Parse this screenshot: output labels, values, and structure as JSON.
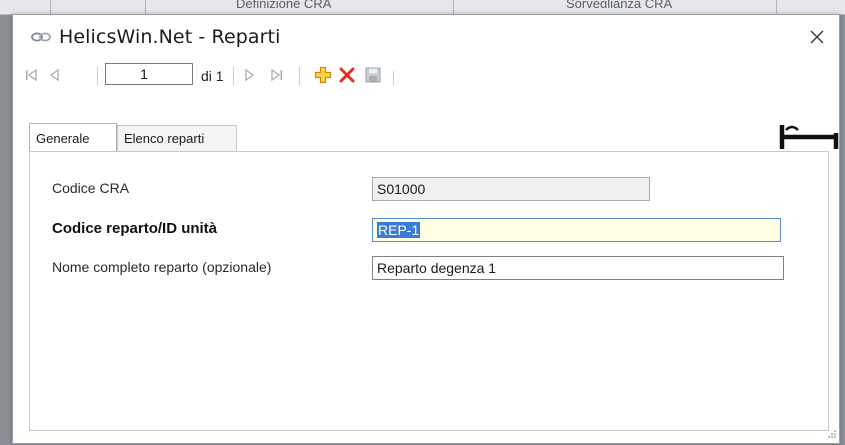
{
  "background_app": {
    "tabs": [
      "Definizione CRA",
      "Sorveglianza CRA"
    ]
  },
  "window": {
    "title": "HelicsWin.Net - Reparti",
    "icons": {
      "app": "link-icon",
      "close": "close-icon"
    }
  },
  "toolbar": {
    "position_value": "1",
    "of_label": "di 1",
    "icons": [
      "first-record-icon",
      "previous-record-icon",
      "next-record-icon",
      "last-record-icon",
      "add-icon",
      "delete-icon",
      "save-icon"
    ]
  },
  "tabs": [
    {
      "label": "Generale",
      "active": true
    },
    {
      "label": "Elenco reparti",
      "active": false
    }
  ],
  "form": {
    "codice_cra": {
      "label": "Codice CRA",
      "value": "S01000"
    },
    "codice_reparto": {
      "label": "Codice reparto/ID unità",
      "value": "REP-1"
    },
    "nome_reparto": {
      "label": "Nome completo reparto (opzionale)",
      "value": "Reparto degenza 1"
    }
  },
  "colors": {
    "add": "#f0b400",
    "delete": "#e0321e",
    "selection": "#3a7bd5",
    "focused_field": "#ffffe1"
  },
  "decor": {
    "bed_icon": "bed-icon"
  }
}
